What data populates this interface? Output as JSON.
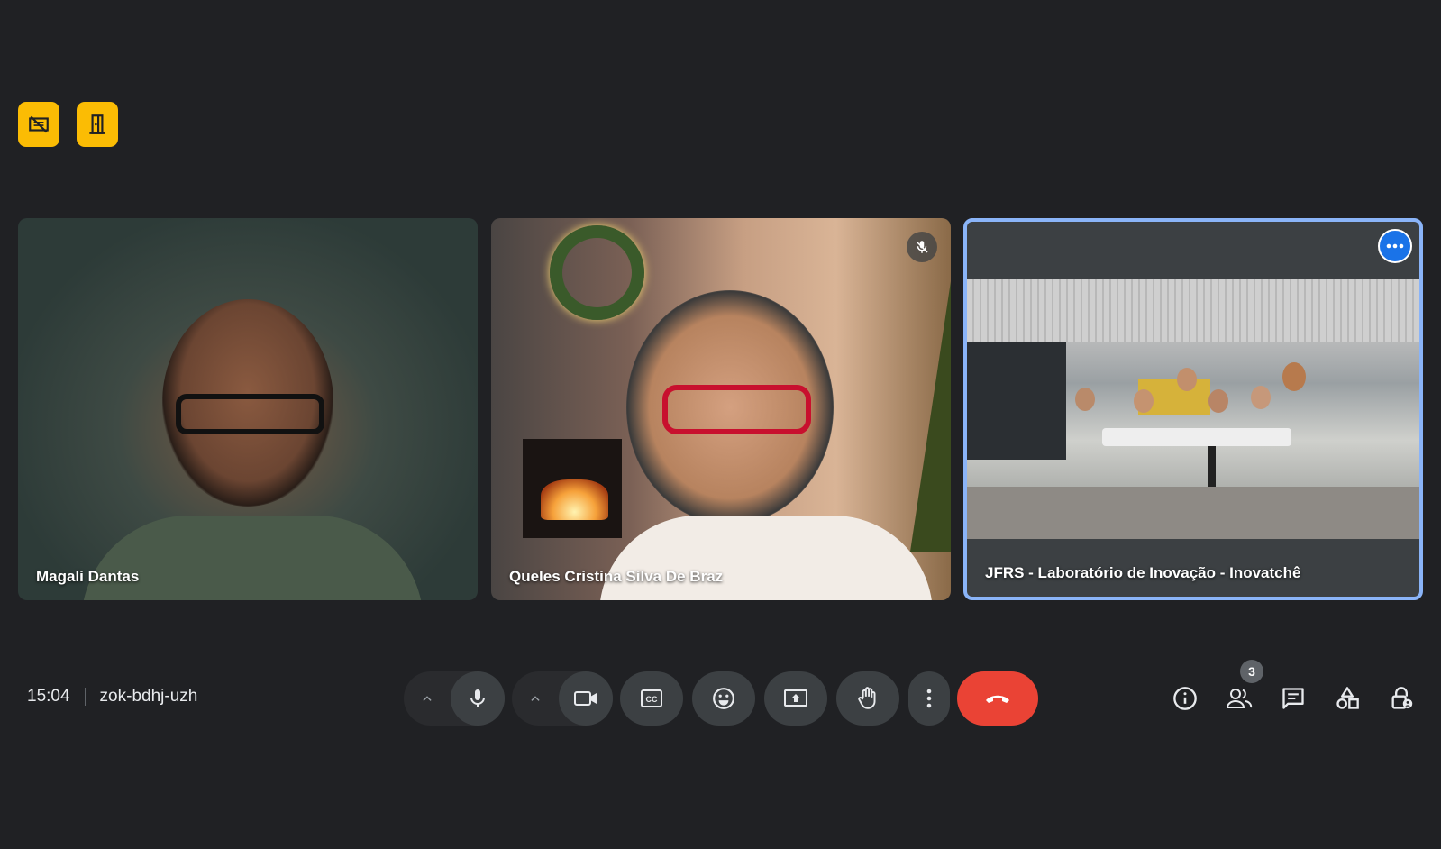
{
  "top_actions": [
    {
      "icon": "no-video-icon"
    },
    {
      "icon": "leave-room-icon"
    }
  ],
  "participants": [
    {
      "name": "Magali Dantas",
      "muted": false
    },
    {
      "name": "Queles Cristina Silva De Braz",
      "muted": true
    },
    {
      "name": "JFRS - Laboratório de Inovação - Inovatchê",
      "pinned": true
    }
  ],
  "meeting": {
    "time": "15:04",
    "code": "zok-bdhj-uzh"
  },
  "people_count": "3",
  "colors": {
    "background": "#202124",
    "accent_yellow": "#fbbc04",
    "highlight_border": "#8ab4f8",
    "end_call": "#ea4335",
    "control": "#3c4043"
  }
}
